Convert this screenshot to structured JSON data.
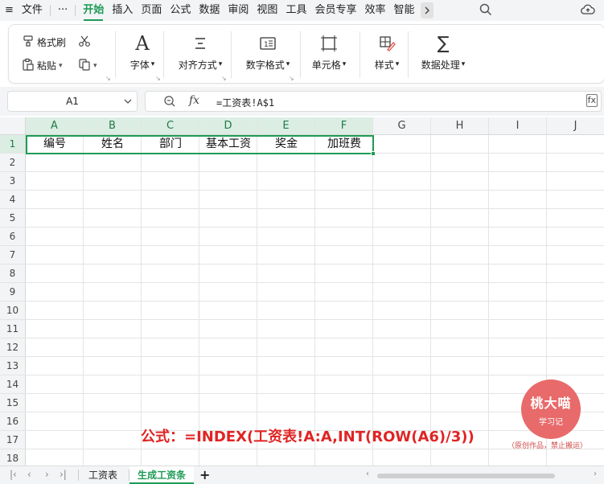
{
  "menu": {
    "hamburger": "≡",
    "file": "文件",
    "more": "···",
    "tabs": [
      "开始",
      "插入",
      "页面",
      "公式",
      "数据",
      "审阅",
      "视图",
      "工具",
      "会员专享",
      "效率",
      "智能"
    ]
  },
  "ribbon": {
    "format_painter": "格式刷",
    "paste": "粘贴",
    "font": "字体",
    "align": "对齐方式",
    "number_format": "数字格式",
    "cell": "单元格",
    "style": "样式",
    "data_process": "数据处理"
  },
  "formula_bar": {
    "name_box": "A1",
    "fx": "fx",
    "formula": "=工资表!A$1"
  },
  "columns": [
    "A",
    "B",
    "C",
    "D",
    "E",
    "F",
    "G",
    "H",
    "I",
    "J"
  ],
  "rows": [
    "1",
    "2",
    "3",
    "4",
    "5",
    "6",
    "7",
    "8",
    "9",
    "10",
    "11",
    "12",
    "13",
    "14",
    "15",
    "16",
    "17",
    "18"
  ],
  "row1": [
    "编号",
    "姓名",
    "部门",
    "基本工资",
    "奖金",
    "加班费"
  ],
  "sheets": [
    "工资表",
    "生成工资条"
  ],
  "add_sheet": "+",
  "annotation": "公式：=INDEX(工资表!A:A,INT(ROW(A6)/3))",
  "logo": {
    "name": "桃大喵",
    "sub": "学习记",
    "note": "（原创作品，禁止搬运）"
  },
  "colors": {
    "accent": "#1e9b55",
    "annotation": "#e02424",
    "logo": "#e86a6a"
  },
  "icons": [
    "format-painter-icon",
    "cut-icon",
    "paste-icon",
    "copy-icon",
    "font-icon",
    "align-icon",
    "number-format-icon",
    "cell-icon",
    "style-icon",
    "sum-icon",
    "search-icon",
    "cloud-icon",
    "zoom-icon",
    "expand-icon"
  ]
}
